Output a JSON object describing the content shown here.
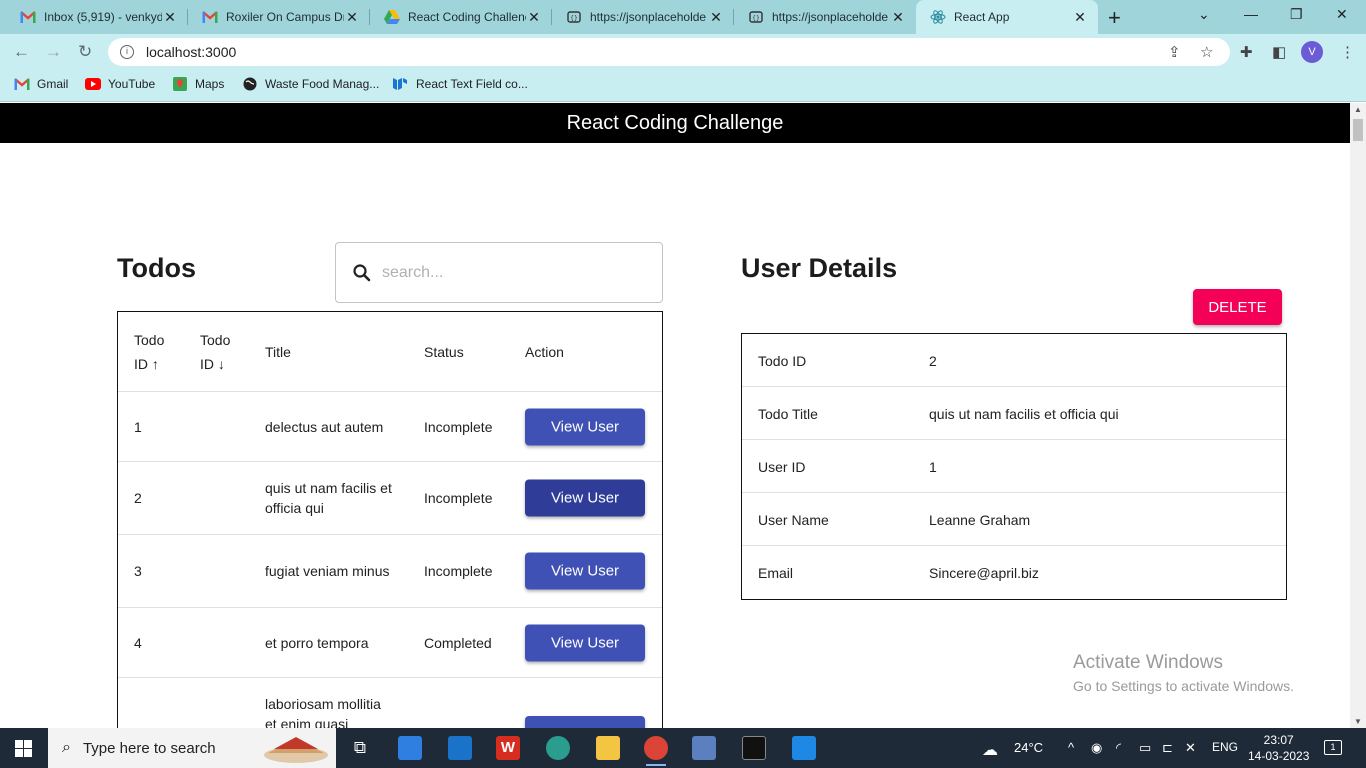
{
  "browser": {
    "tabs": [
      {
        "title": "Inbox (5,919) - venkyd",
        "icon": "gmail-icon",
        "active": false
      },
      {
        "title": "Roxiler On Campus Dr",
        "icon": "gmail-icon",
        "active": false
      },
      {
        "title": "React Coding Challenc",
        "icon": "drive-icon",
        "active": false
      },
      {
        "title": "https://jsonplaceholde",
        "icon": "globe-icon",
        "active": false
      },
      {
        "title": "https://jsonplaceholde",
        "icon": "globe-icon",
        "active": false
      },
      {
        "title": "React App",
        "icon": "react-icon",
        "active": true
      }
    ],
    "address": "localhost:3000",
    "profile_initial": "V",
    "bookmarks": [
      {
        "label": "Gmail",
        "icon": "gmail-icon"
      },
      {
        "label": "YouTube",
        "icon": "youtube-icon"
      },
      {
        "label": "Maps",
        "icon": "maps-icon"
      },
      {
        "label": "Waste Food Manag...",
        "icon": "globe-icon"
      },
      {
        "label": "React Text Field co...",
        "icon": "mui-icon"
      }
    ]
  },
  "app": {
    "header": "React Coding Challenge",
    "todos": {
      "title": "Todos",
      "search_placeholder": "search...",
      "columns": {
        "id_asc": [
          "Todo",
          "ID ↑"
        ],
        "id_desc": [
          "Todo",
          "ID ↓"
        ],
        "title": "Title",
        "status": "Status",
        "action": "Action"
      },
      "rows": [
        {
          "id": "1",
          "title": "delectus aut autem",
          "status": "Incomplete",
          "action": "View User"
        },
        {
          "id": "2",
          "title": "quis ut nam facilis et officia qui",
          "status": "Incomplete",
          "action": "View User"
        },
        {
          "id": "3",
          "title": "fugiat veniam minus",
          "status": "Incomplete",
          "action": "View User"
        },
        {
          "id": "4",
          "title": "et porro tempora",
          "status": "Completed",
          "action": "View User"
        },
        {
          "id": "",
          "title": "laboriosam mollitia et enim quasi",
          "status": "",
          "action": "View User"
        }
      ]
    },
    "user_details": {
      "title": "User Details",
      "delete_label": "DELETE",
      "rows": [
        {
          "label": "Todo ID",
          "value": "2"
        },
        {
          "label": "Todo Title",
          "value": "quis ut nam facilis et officia qui"
        },
        {
          "label": "User ID",
          "value": "1"
        },
        {
          "label": "User Name",
          "value": "Leanne Graham"
        },
        {
          "label": "Email",
          "value": "Sincere@april.biz"
        }
      ]
    }
  },
  "watermark": {
    "line1": "Activate Windows",
    "line2": "Go to Settings to activate Windows."
  },
  "taskbar": {
    "search_placeholder": "Type here to search",
    "weather": "24°C",
    "language": "ENG",
    "time": "23:07",
    "date": "14-03-2023",
    "notification_count": "1"
  },
  "colors": {
    "primary": "#3f51b5",
    "secondary": "#f50057",
    "appbar": "#000000",
    "chrome": "#c8eef2"
  }
}
